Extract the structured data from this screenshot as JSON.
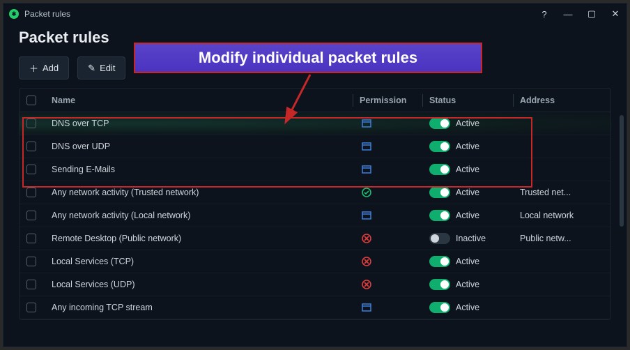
{
  "window": {
    "title": "Packet rules"
  },
  "page": {
    "title": "Packet rules"
  },
  "toolbar": {
    "add": "Add",
    "edit": "Edit"
  },
  "callout": {
    "text": "Modify individual packet rules"
  },
  "columns": {
    "name": "Name",
    "permission": "Permission",
    "status": "Status",
    "address": "Address"
  },
  "status_labels": {
    "active": "Active",
    "inactive": "Inactive"
  },
  "rows": [
    {
      "name": "DNS over TCP",
      "perm": "block",
      "active": true,
      "address": ""
    },
    {
      "name": "DNS over UDP",
      "perm": "block",
      "active": true,
      "address": ""
    },
    {
      "name": "Sending E-Mails",
      "perm": "block",
      "active": true,
      "address": ""
    },
    {
      "name": "Any network activity (Trusted network)",
      "perm": "allow",
      "active": true,
      "address": "Trusted net..."
    },
    {
      "name": "Any network activity (Local network)",
      "perm": "block",
      "active": true,
      "address": "Local network"
    },
    {
      "name": "Remote Desktop (Public network)",
      "perm": "deny",
      "active": false,
      "address": "Public netw..."
    },
    {
      "name": "Local Services (TCP)",
      "perm": "deny",
      "active": true,
      "address": ""
    },
    {
      "name": "Local Services (UDP)",
      "perm": "deny",
      "active": true,
      "address": ""
    },
    {
      "name": "Any incoming TCP stream",
      "perm": "block",
      "active": true,
      "address": ""
    }
  ]
}
